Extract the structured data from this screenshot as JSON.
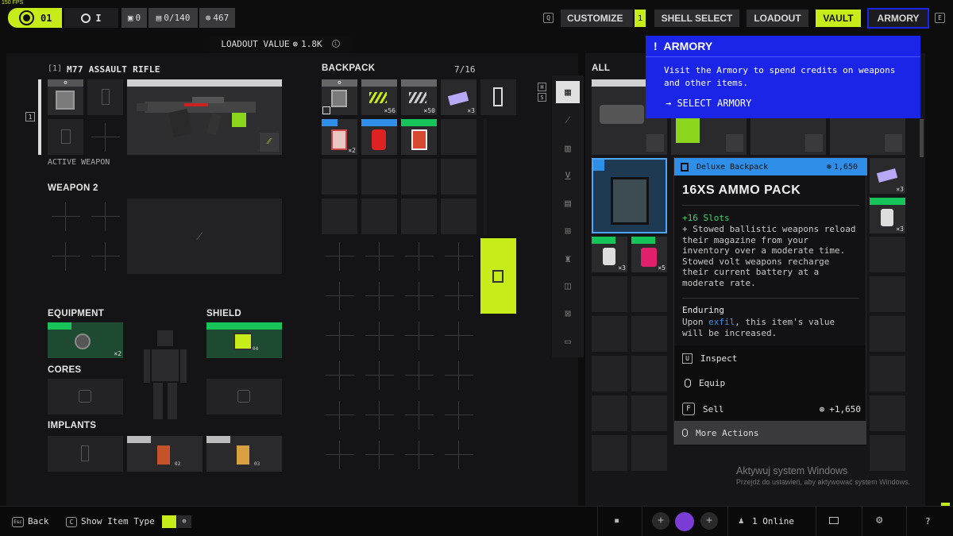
{
  "fps": "150 FPS",
  "topbar": {
    "player_level": "01",
    "rank": "I",
    "stat1": "0",
    "stat2": "0/140",
    "stat3": "467",
    "nav_key_left": "Q",
    "nav_key_right": "E",
    "customize": "CUSTOMIZE",
    "customize_badge": "1",
    "shell_select": "SHELL SELECT",
    "loadout": "LOADOUT",
    "vault": "VAULT",
    "armory": "ARMORY"
  },
  "loadout_value": "LOADOUT VALUE",
  "loadout_amount": "1.8K",
  "weapon1": {
    "slot": "[1]",
    "name": "M77 ASSAULT RIFLE",
    "active": "ACTIVE WEAPON",
    "side_index": "1"
  },
  "weapon2": {
    "title": "WEAPON 2"
  },
  "equipment": {
    "title": "EQUIPMENT",
    "qty": "×2"
  },
  "shield": {
    "title": "SHIELD",
    "tag": "04"
  },
  "cores": {
    "title": "CORES"
  },
  "implants": {
    "title": "IMPLANTS",
    "tag1": "02",
    "tag2": "03"
  },
  "backpack": {
    "title": "BACKPACK",
    "count": "7/16",
    "q1": "×56",
    "q2": "×50",
    "q3": "×3",
    "q4": "×2",
    "hs_h": "H",
    "hs_s": "S"
  },
  "vault": {
    "title": "ALL",
    "q1": "×3",
    "q2": "×3",
    "q3": "×3",
    "q4": "×3",
    "q5": "×5"
  },
  "armory_popup": {
    "title": "ARMORY",
    "body": "Visit the Armory to spend credits on weapons and other items.",
    "action": "→ SELECT ARMORY"
  },
  "tooltip": {
    "type": "Deluxe Backpack",
    "price": "1,650",
    "name": "16XS AMMO PACK",
    "slots": "+16 Slots",
    "desc": "+ Stowed ballistic weapons reload their magazine from your inventory over a moderate time. Stowed volt weapons recharge their current battery at a moderate rate.",
    "trait": "Enduring",
    "trait_pre": "Upon ",
    "trait_link": "exfil",
    "trait_post": ", this item's value will be increased.",
    "inspect_key": "U",
    "inspect": "Inspect",
    "equip": "Equip",
    "sell_key": "F",
    "sell": "Sell",
    "sell_value": "+1,650",
    "more": "More Actions"
  },
  "watermark": {
    "line1": "Aktywuj system Windows",
    "line2": "Przejdź do ustawień, aby aktywować system Windows."
  },
  "bottom": {
    "back_key": "Esc",
    "back": "Back",
    "show_key": "C",
    "show": "Show Item Type",
    "online": "1 Online",
    "help": "?"
  },
  "colors": {
    "accent": "#c6ec1a",
    "armory": "#1a25e8",
    "tag_blue": "#2e8ee8",
    "tag_green": "#17c45a"
  }
}
